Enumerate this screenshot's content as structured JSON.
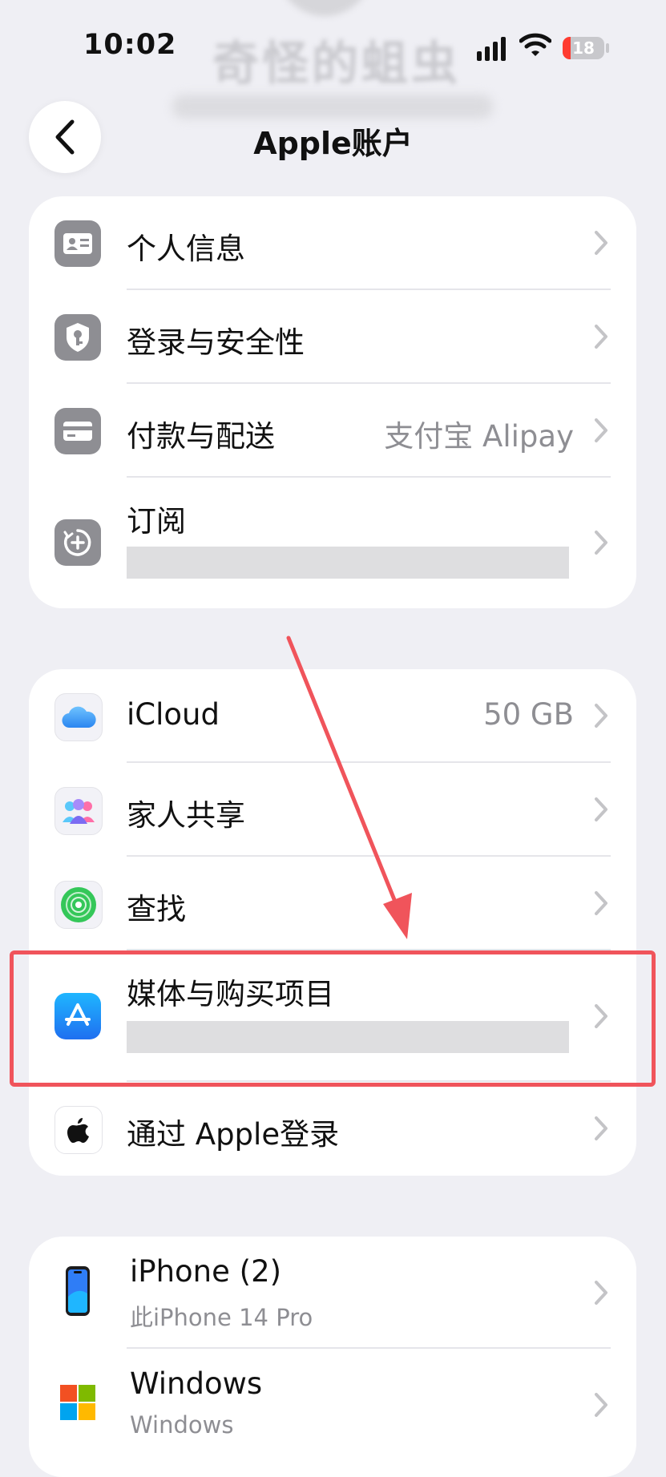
{
  "status_bar": {
    "time": "10:02",
    "battery": "18"
  },
  "profile": {
    "name": "奇怪的蛆虫"
  },
  "nav": {
    "title": "Apple账户"
  },
  "group1": {
    "items": [
      {
        "label": "个人信息",
        "icon": "person-card-icon"
      },
      {
        "label": "登录与安全性",
        "icon": "shield-key-icon"
      },
      {
        "label": "付款与配送",
        "value": "支付宝 Alipay",
        "icon": "credit-card-icon"
      },
      {
        "label": "订阅",
        "icon": "subscription-icon"
      }
    ]
  },
  "group2": {
    "items": [
      {
        "label": "iCloud",
        "value": "50 GB",
        "icon": "icloud-icon"
      },
      {
        "label": "家人共享",
        "icon": "family-sharing-icon"
      },
      {
        "label": "查找",
        "icon": "find-my-icon"
      },
      {
        "label": "媒体与购买项目",
        "icon": "app-store-icon"
      },
      {
        "label": "通过 Apple登录",
        "icon": "apple-logo-icon"
      }
    ]
  },
  "devices": {
    "items": [
      {
        "label": "iPhone (2)",
        "sub": "此iPhone 14 Pro",
        "icon": "iphone-icon"
      },
      {
        "label": "Windows",
        "sub": "Windows",
        "icon": "windows-logo-icon"
      }
    ]
  },
  "colors": {
    "accent_red": "#f0545b",
    "chevron": "#c4c4c7",
    "background": "#efeff4"
  }
}
